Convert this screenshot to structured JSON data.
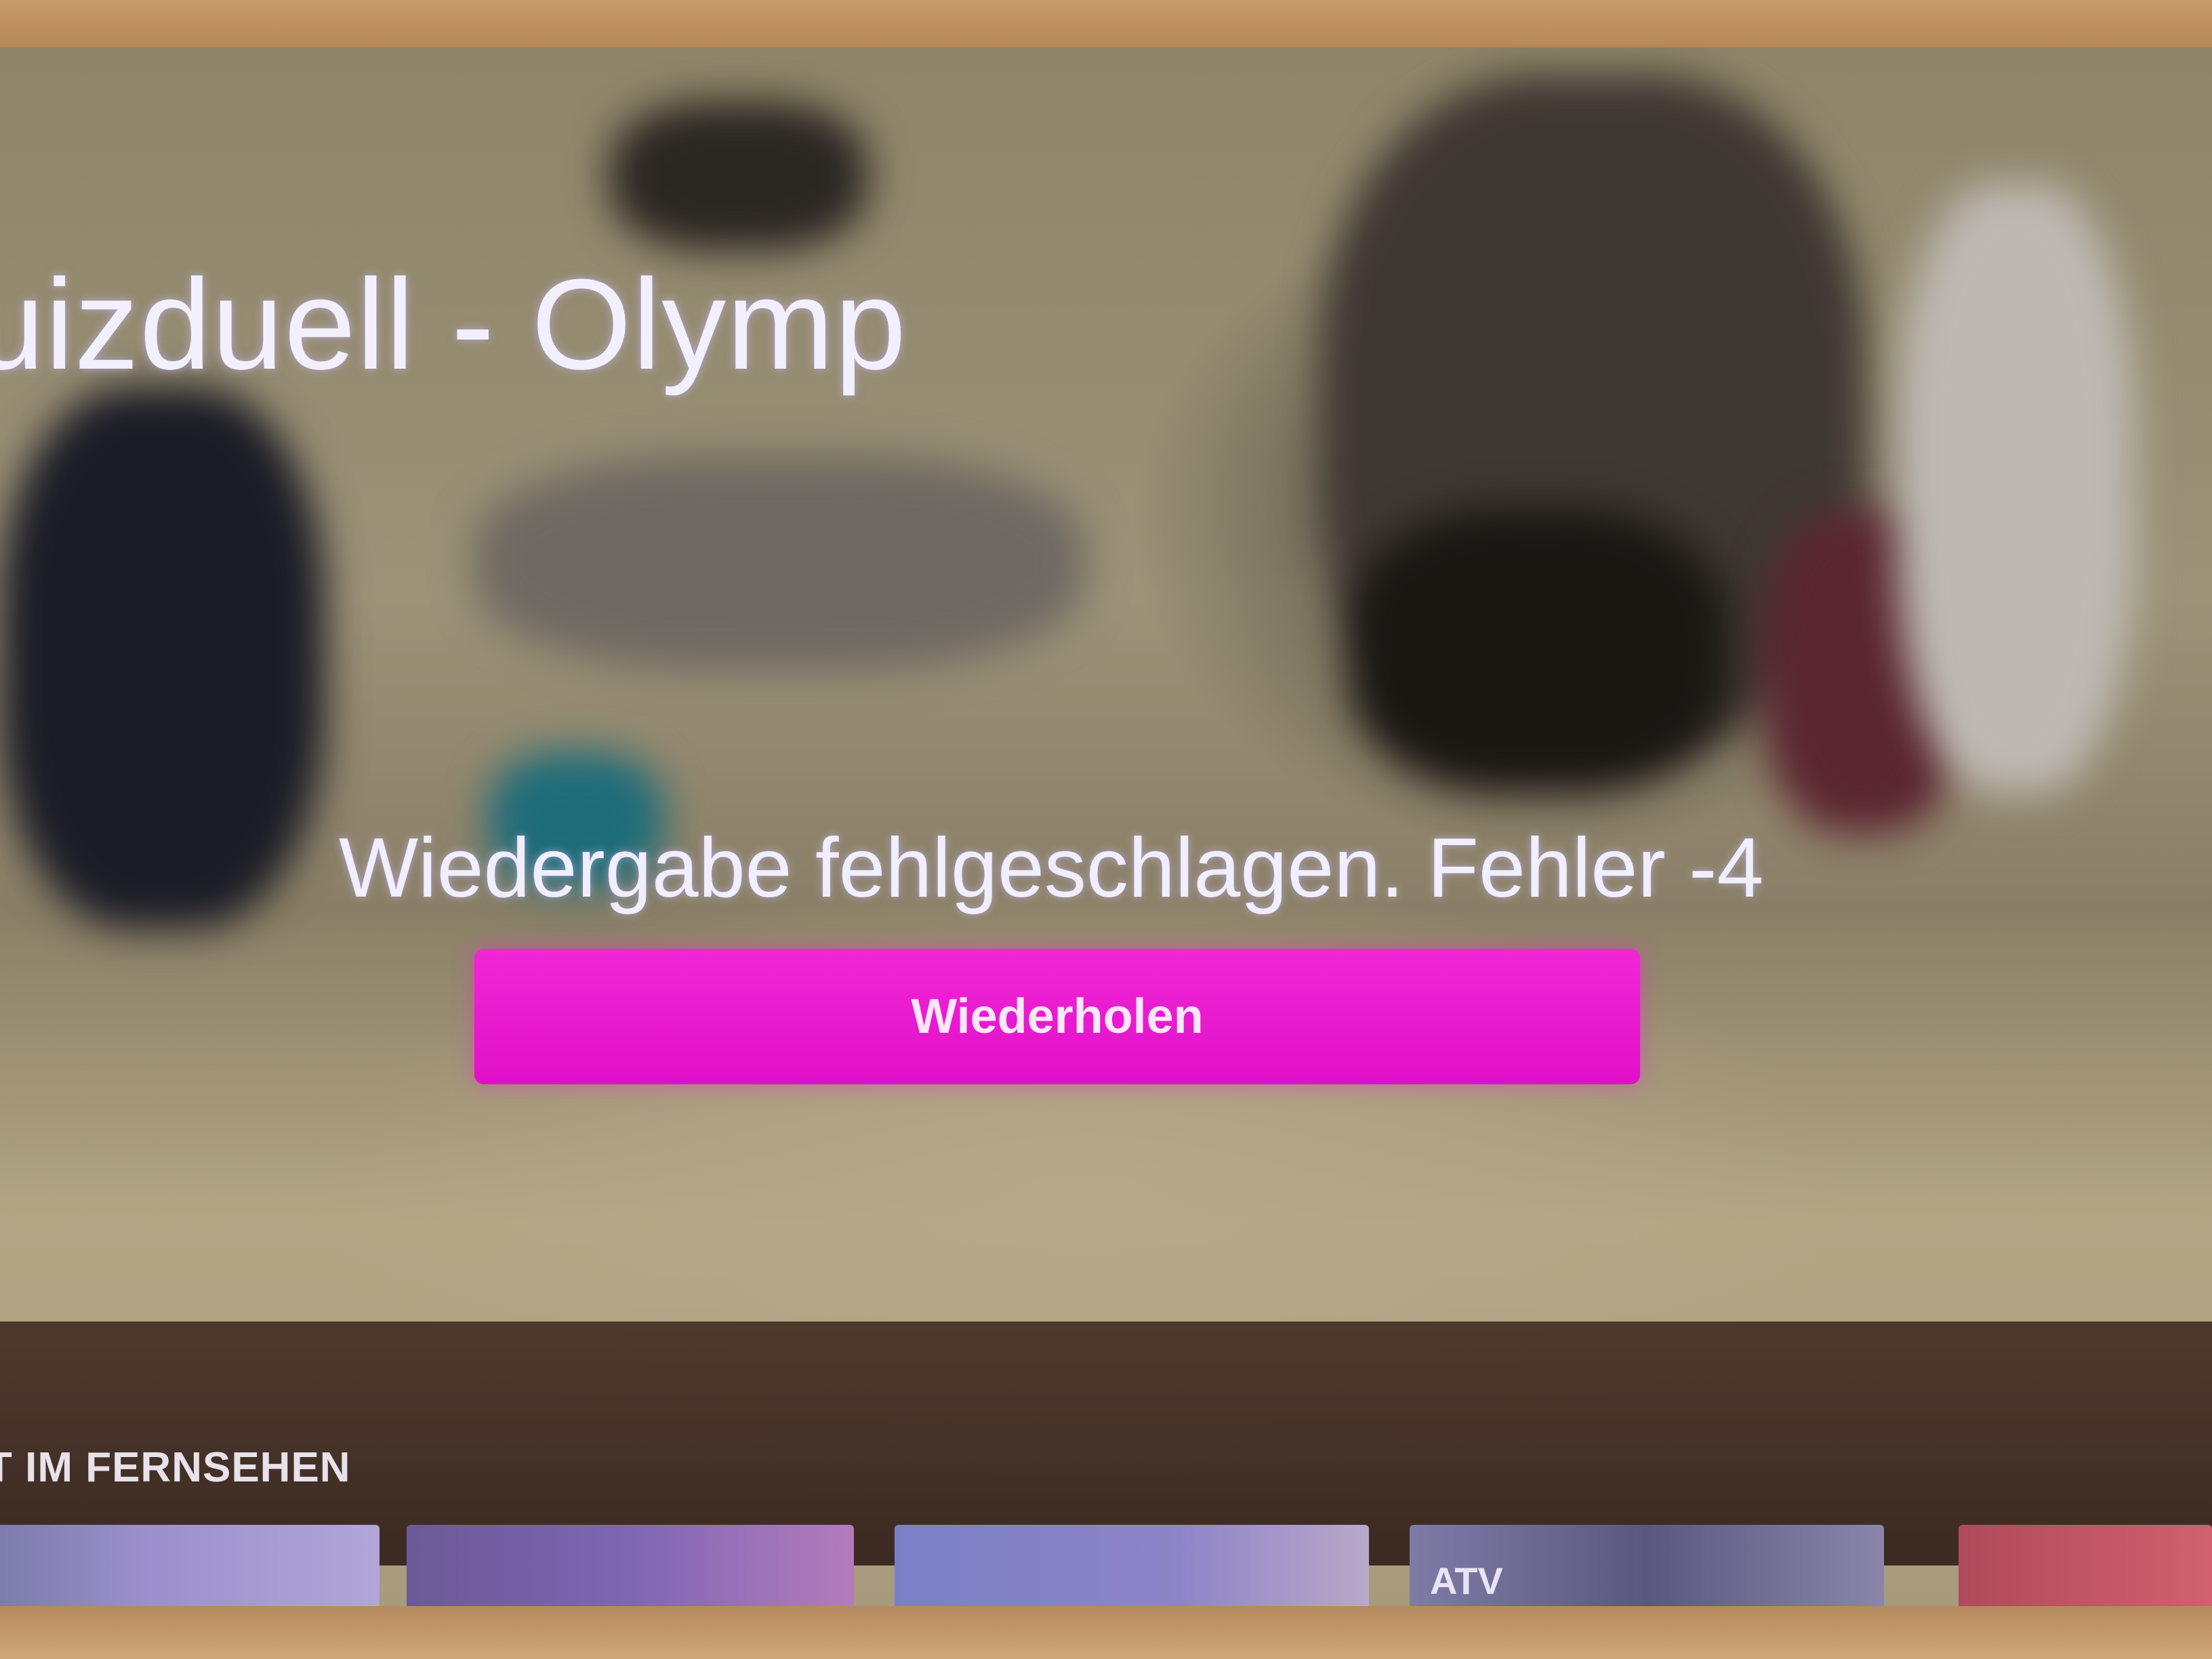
{
  "player": {
    "show_title": "uizduell - Olymp",
    "error_message": "Wiedergabe fehlgeschlagen. Fehler -4",
    "retry_label": "Wiederholen",
    "accent_color": "#e31fd0"
  },
  "shelf": {
    "heading": "T IM FERNSEHEN",
    "tiles": [
      {
        "label": ""
      },
      {
        "label": ""
      },
      {
        "label": ""
      },
      {
        "label": "ATV"
      },
      {
        "label": ""
      }
    ]
  }
}
